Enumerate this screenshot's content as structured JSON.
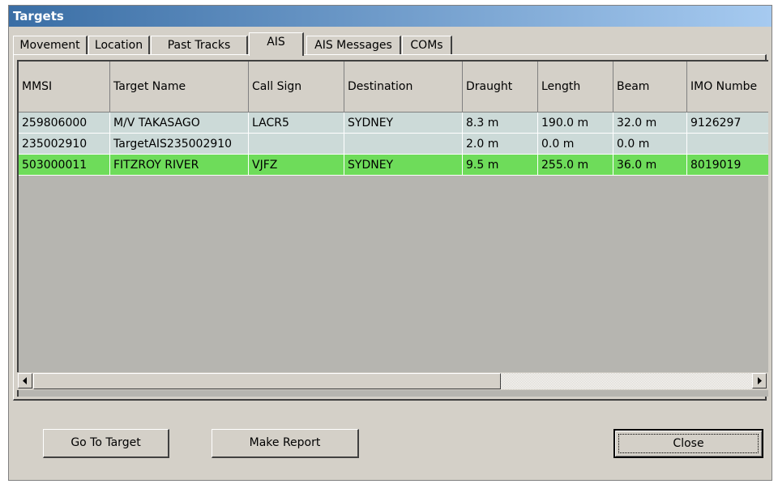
{
  "window": {
    "title": "Targets"
  },
  "tabs": [
    {
      "label": "Movement",
      "active": false
    },
    {
      "label": "Location",
      "active": false
    },
    {
      "label": "Past Tracks",
      "active": false
    },
    {
      "label": "AIS",
      "active": true
    },
    {
      "label": "AIS Messages",
      "active": false
    },
    {
      "label": "COMs",
      "active": false
    }
  ],
  "table": {
    "columns": [
      "MMSI",
      "Target Name",
      "Call Sign",
      "Destination",
      "Draught",
      "Length",
      "Beam",
      "IMO Numbe"
    ],
    "rows": [
      {
        "cells": [
          "259806000",
          "M/V TAKASAGO",
          "LACR5",
          "SYDNEY",
          "8.3 m",
          "190.0 m",
          "32.0 m",
          "9126297"
        ],
        "selected": false
      },
      {
        "cells": [
          "235002910",
          "TargetAIS235002910",
          "",
          "",
          "2.0 m",
          "0.0 m",
          "0.0 m",
          ""
        ],
        "selected": false
      },
      {
        "cells": [
          "503000011",
          "FITZROY RIVER",
          "VJFZ",
          "SYDNEY",
          "9.5 m",
          "255.0 m",
          "36.0 m",
          "8019019"
        ],
        "selected": true
      }
    ]
  },
  "scrollbar": {
    "left_icon": "arrow-left-icon",
    "right_icon": "arrow-right-icon"
  },
  "buttons": {
    "go_to_target": "Go To Target",
    "make_report": "Make Report",
    "close": "Close"
  },
  "colors": {
    "row_normal": "#ccdad8",
    "row_selected": "#6edc5a",
    "titlebar": "#3a6ea5"
  }
}
